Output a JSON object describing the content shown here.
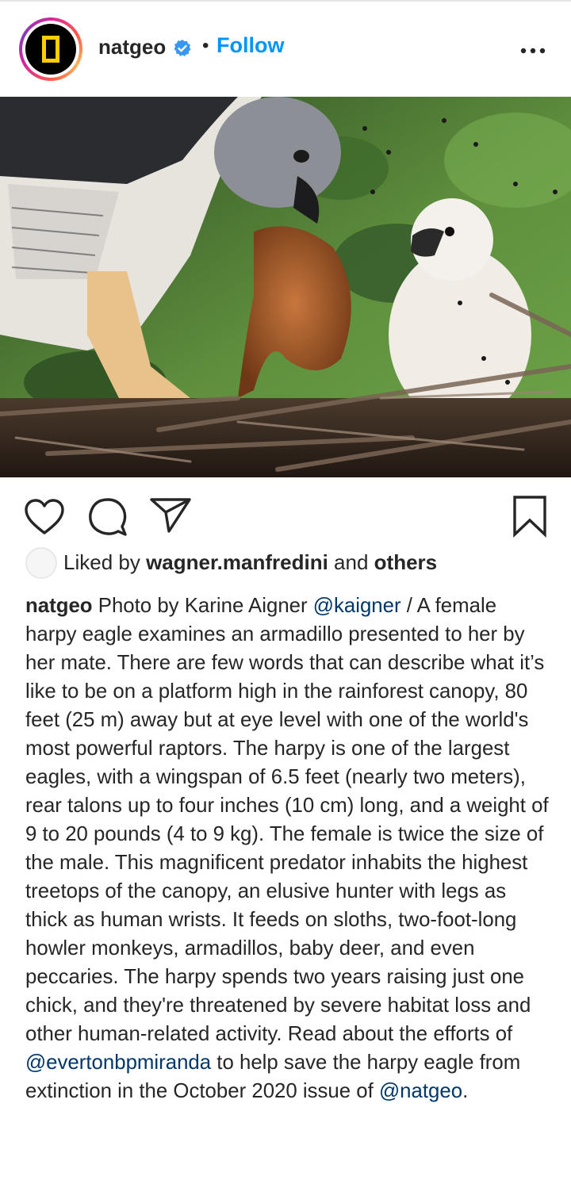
{
  "header": {
    "username": "natgeo",
    "separator": "•",
    "follow_label": "Follow"
  },
  "actions": {
    "icons": [
      "heart-icon",
      "comment-icon",
      "share-icon",
      "bookmark-icon"
    ]
  },
  "likes": {
    "prefix": "Liked by",
    "liker": "wagner.manfredini",
    "conjunction": "and",
    "others": "others"
  },
  "caption": {
    "username": "natgeo",
    "text_1": "Photo by Karine Aigner",
    "mention_1": "@kaigner",
    "text_2": "/ A female harpy eagle examines an armadillo presented to her by her mate. There are few words that can describe what it’s like to be on a platform high in the rainforest canopy, 80 feet (25 m) away but at eye level with one of the world's most powerful raptors. The harpy is one of the largest eagles, with a wingspan of 6.5 feet (nearly two meters), rear talons up to four inches (10 cm) long, and a weight of 9 to 20 pounds (4 to 9 kg). The female is twice the size of the male. This magnificent predator inhabits the highest treetops of the canopy, an elusive hunter with legs as thick as human wrists. It feeds on sloths, two-foot-long howler monkeys, armadillos, baby deer, and even peccaries. The harpy spends two years raising just one chick, and they're threatened by severe habitat loss and other human-related activity. Read about the efforts of",
    "mention_2": "@evertonbpmiranda",
    "text_3": "to help save the harpy eagle from extinction in the October 2020 issue of",
    "mention_3": "@natgeo",
    "text_4": "."
  },
  "colors": {
    "follow": "#0095f6",
    "mention": "#00376b",
    "verified": "#3897f0",
    "natgeo_yellow": "#ffcd00"
  }
}
